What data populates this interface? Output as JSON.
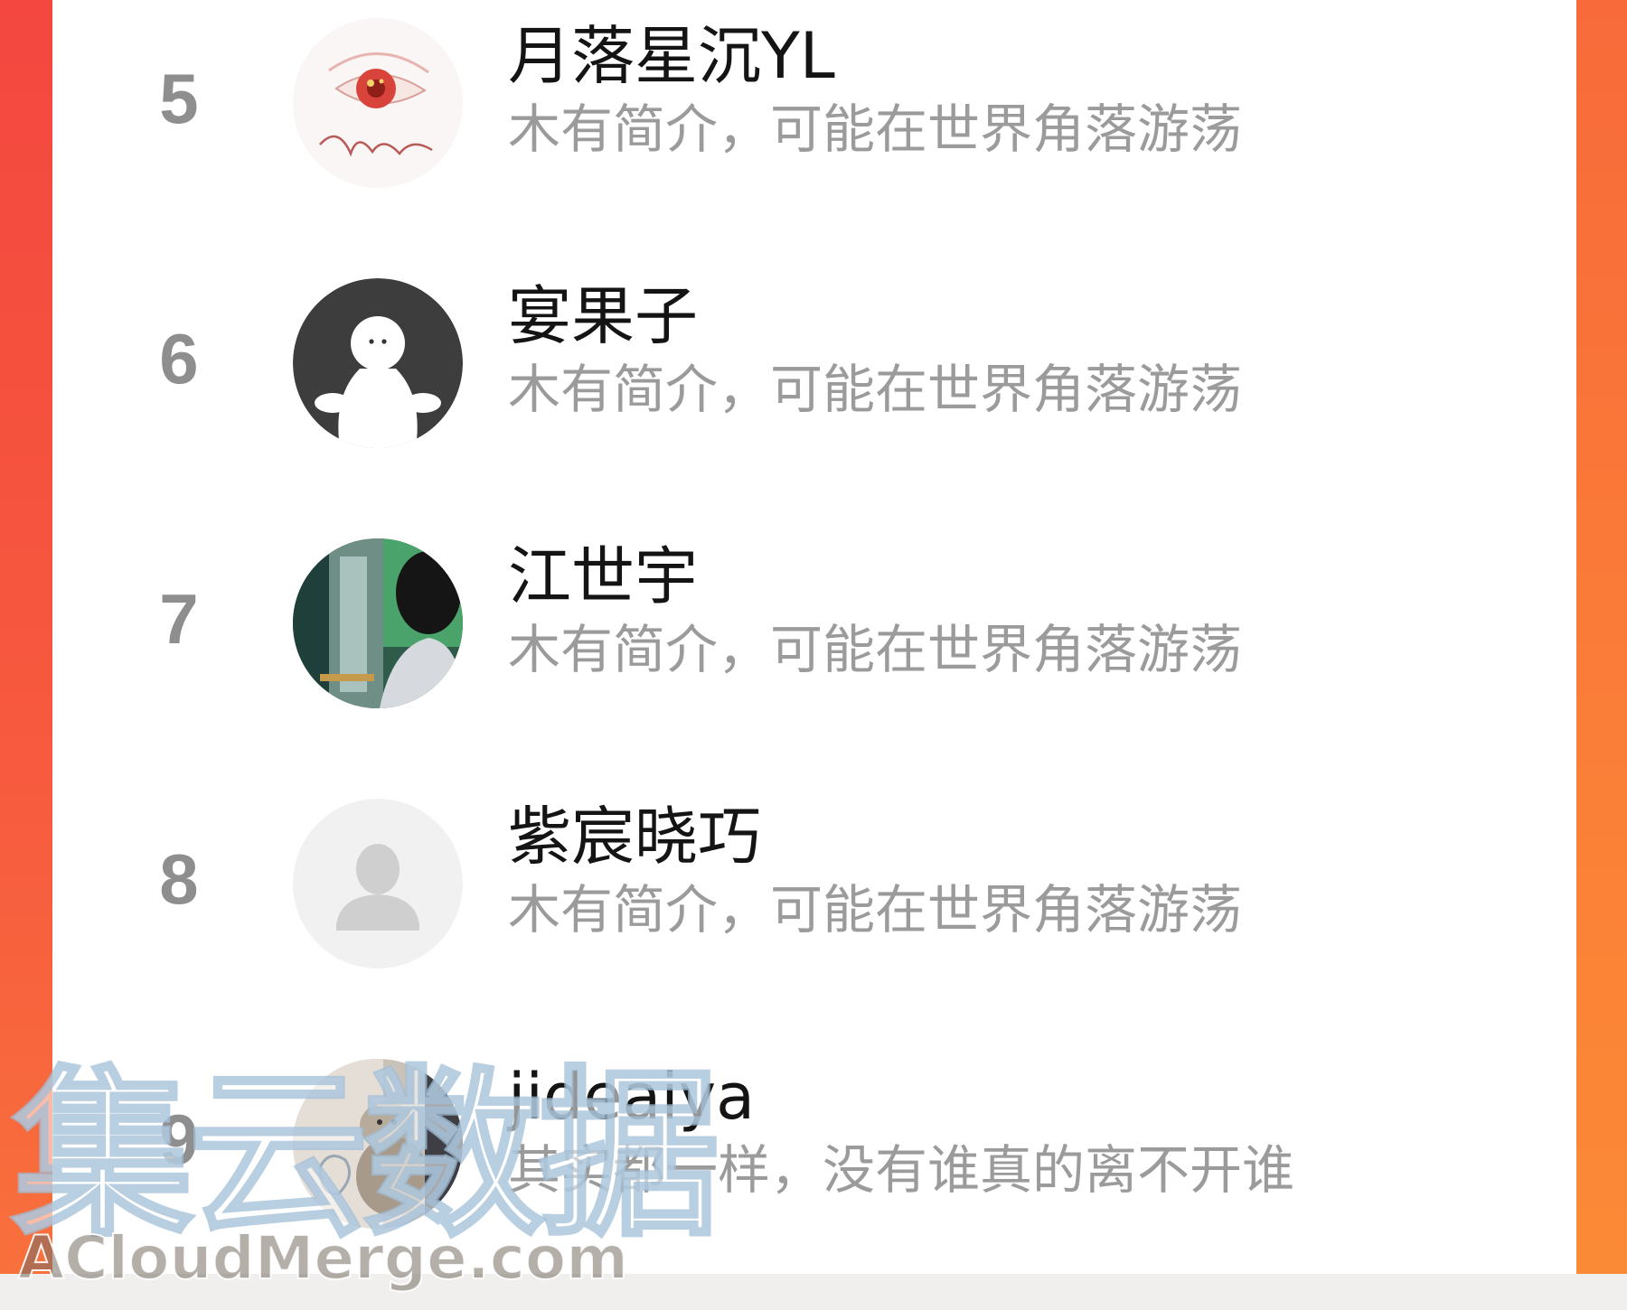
{
  "colors": {
    "accent_left": "#f3473f",
    "accent_right": "#fb8237",
    "name_text": "#141414",
    "intro_text": "#9b9b9b",
    "rank_text": "#8e8e8e"
  },
  "list": {
    "items": [
      {
        "rank": "5",
        "name": "月落星沉YL",
        "intro": "木有简介，可能在世界角落游荡",
        "avatar_icon": "eye-painting-avatar"
      },
      {
        "rank": "6",
        "name": "宴果子",
        "intro": "木有简介，可能在世界角落游荡",
        "avatar_icon": "ghost-figure-avatar"
      },
      {
        "rank": "7",
        "name": "江世宇",
        "intro": "木有简介，可能在世界角落游荡",
        "avatar_icon": "photo-avatar"
      },
      {
        "rank": "8",
        "name": "紫宸晓巧",
        "intro": "木有简介，可能在世界角落游荡",
        "avatar_icon": "default-person-avatar"
      },
      {
        "rank": "9",
        "name": "jideaiya",
        "intro": "其实都一样，没有谁真的离不开谁",
        "avatar_icon": "plush-toy-avatar"
      }
    ]
  },
  "watermark": {
    "main": "集云数据",
    "sub": "ACloudMerge.com"
  }
}
